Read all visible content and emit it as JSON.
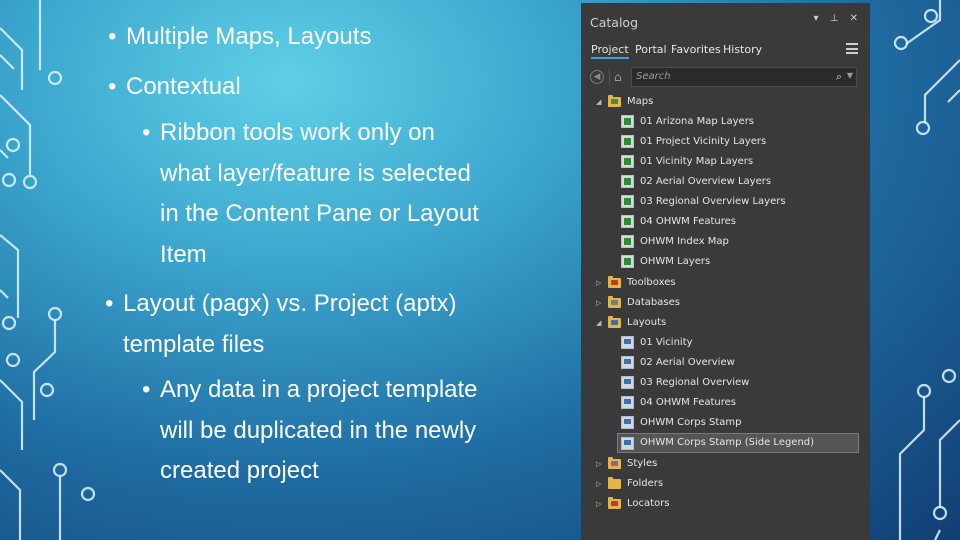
{
  "slide": {
    "bullets": [
      {
        "lines": [
          "Multiple Maps, Layouts"
        ]
      },
      {
        "lines": [
          "Contextual"
        ]
      },
      {
        "lines": [
          "Ribbon tools work only on",
          "what layer/feature is selected",
          "in the Content Pane or Layout",
          "Item"
        ]
      },
      {
        "lines": [
          "Layout (pagx) vs. Project (aptx)",
          "template files"
        ]
      },
      {
        "lines": [
          "Any data in a project template",
          "will be duplicated in the newly",
          "created project"
        ]
      }
    ],
    "bullet_char": "•"
  },
  "catalog": {
    "title": "Catalog",
    "title_icons": "▾ ⊥ ✕",
    "tabs": [
      "Project",
      "Portal",
      "Favorites",
      "History"
    ],
    "active_tab": "Project",
    "search_placeholder": "Search",
    "tree": {
      "maps": {
        "label": "Maps",
        "items": [
          "01 Arizona Map Layers",
          "01 Project Vicinity Layers",
          "01 Vicinity Map Layers",
          "02 Aerial Overview Layers",
          "03 Regional Overview Layers",
          "04 OHWM Features",
          "OHWM Index Map",
          "OHWM Layers"
        ]
      },
      "toolboxes": {
        "label": "Toolboxes"
      },
      "databases": {
        "label": "Databases"
      },
      "layouts": {
        "label": "Layouts",
        "items": [
          "01 Vicinity",
          "02 Aerial Overview",
          "03 Regional Overview",
          "04 OHWM Features",
          "OHWM Corps Stamp",
          "OHWM Corps Stamp (Side Legend)"
        ],
        "selected": "OHWM Corps Stamp (Side Legend)"
      },
      "styles": {
        "label": "Styles"
      },
      "folders": {
        "label": "Folders"
      },
      "locators": {
        "label": "Locators"
      }
    },
    "colors": {
      "accent": "#39a0e6",
      "folder": "#e0b64a",
      "panel": "#3a3a3a"
    }
  }
}
